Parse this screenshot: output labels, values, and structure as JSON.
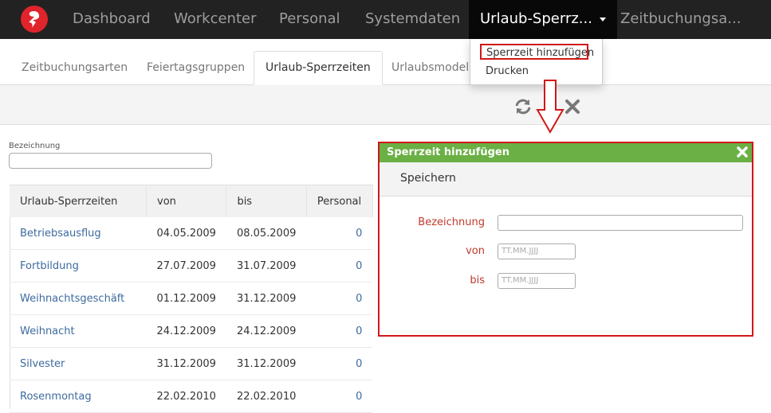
{
  "nav": {
    "items": [
      "Dashboard",
      "Workcenter",
      "Personal",
      "Systemdaten",
      "Urlaub-Sperrz...",
      "Zeitbuchungsa..."
    ]
  },
  "dropdown": {
    "items": [
      "Sperrzeit hinzufügen",
      "Drucken"
    ]
  },
  "tabs": [
    "Zeitbuchungsarten",
    "Feiertagsgruppen",
    "Urlaub-Sperrzeiten",
    "Urlaubsmodell"
  ],
  "filter": {
    "label": "Bezeichnung",
    "value": ""
  },
  "table": {
    "headers": [
      "Urlaub-Sperrzeiten",
      "von",
      "bis",
      "Personal"
    ],
    "rows": [
      [
        "Betriebsausflug",
        "04.05.2009",
        "08.05.2009",
        "0"
      ],
      [
        "Fortbildung",
        "27.07.2009",
        "31.07.2009",
        "0"
      ],
      [
        "Weihnachtsgeschäft",
        "01.12.2009",
        "31.12.2009",
        "0"
      ],
      [
        "Weihnacht",
        "24.12.2009",
        "24.12.2009",
        "0"
      ],
      [
        "Silvester",
        "31.12.2009",
        "31.12.2009",
        "0"
      ],
      [
        "Rosenmontag",
        "22.02.2010",
        "22.02.2010",
        "0"
      ]
    ]
  },
  "dialog": {
    "title": "Sperrzeit hinzufügen",
    "save_label": "Speichern",
    "fields": {
      "bezeichnung_label": "Bezeichnung",
      "von_label": "von",
      "von_placeholder": "TT.MM.JJJJ",
      "bis_label": "bis",
      "bis_placeholder": "TT.MM.JJJJ"
    }
  },
  "colors": {
    "nav_bg": "#222222",
    "dialog_header": "#6ab044",
    "highlight": "#d01818",
    "link": "#3d6a9e"
  }
}
